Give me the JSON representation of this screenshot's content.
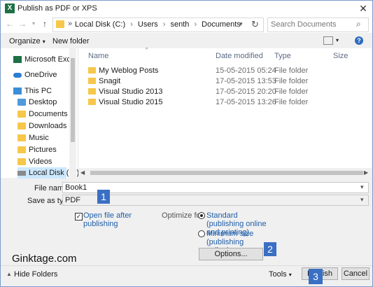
{
  "window": {
    "title": "Publish as PDF or XPS"
  },
  "address": {
    "drive_glyph": "»",
    "path": [
      "Local Disk (C:)",
      "Users",
      "senth",
      "Documents"
    ]
  },
  "search": {
    "placeholder": "Search Documents"
  },
  "toolbar": {
    "organize": "Organize",
    "new_folder": "New folder",
    "help": "?"
  },
  "sidebar": {
    "items": [
      {
        "label": "Microsoft Excel",
        "icon": "excel-icon"
      },
      {
        "label": "OneDrive",
        "icon": "cloud-icon"
      },
      {
        "label": "This PC",
        "icon": "computer-icon"
      },
      {
        "label": "Desktop",
        "icon": "folder-icon"
      },
      {
        "label": "Documents",
        "icon": "folder-icon"
      },
      {
        "label": "Downloads",
        "icon": "folder-icon"
      },
      {
        "label": "Music",
        "icon": "folder-icon"
      },
      {
        "label": "Pictures",
        "icon": "folder-icon"
      },
      {
        "label": "Videos",
        "icon": "folder-icon"
      },
      {
        "label": "Local Disk (C:)",
        "icon": "disk-icon"
      }
    ]
  },
  "files": {
    "columns": [
      "Name",
      "Date modified",
      "Type",
      "Size"
    ],
    "rows": [
      {
        "name": "My Weblog Posts",
        "date": "15-05-2015 05:24",
        "type": "File folder"
      },
      {
        "name": "Snagit",
        "date": "17-05-2015 13:53",
        "type": "File folder"
      },
      {
        "name": "Visual Studio 2013",
        "date": "17-05-2015 20:20",
        "type": "File folder"
      },
      {
        "name": "Visual Studio 2015",
        "date": "17-05-2015 13:26",
        "type": "File folder"
      }
    ]
  },
  "form": {
    "file_name_label": "File name:",
    "file_name_value": "Book1",
    "save_type_label": "Save as type:",
    "save_type_value": "PDF",
    "open_after_label": "Open file after publishing",
    "optimize_label": "Optimize for:",
    "standard_label": "Standard (publishing online and printing)",
    "minimum_label": "Minimum size (publishing online)",
    "options_button": "Options..."
  },
  "badges": [
    "1",
    "2",
    "3"
  ],
  "watermark": "Ginktage.com",
  "footer": {
    "hide_folders": "Hide Folders",
    "tools": "Tools",
    "publish": "Publish",
    "cancel": "Cancel"
  }
}
